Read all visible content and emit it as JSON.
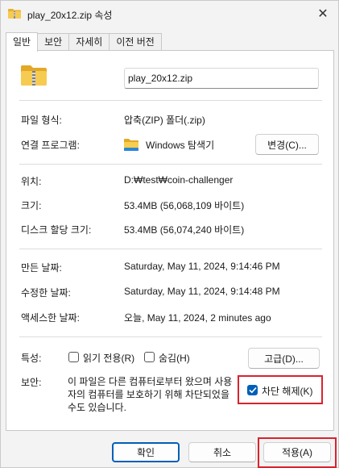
{
  "window": {
    "title": "play_20x12.zip 속성",
    "close_glyph": "✕"
  },
  "tabs": [
    {
      "label": "일반",
      "active": true
    },
    {
      "label": "보안",
      "active": false
    },
    {
      "label": "자세히",
      "active": false
    },
    {
      "label": "이전 버전",
      "active": false
    }
  ],
  "general": {
    "file_name": "play_20x12.zip",
    "file_type_label": "파일 형식:",
    "file_type_value": "압축(ZIP) 폴더(.zip)",
    "opens_with_label": "연결 프로그램:",
    "opens_with_value": "Windows 탐색기",
    "change_button": "변경(C)...",
    "location_label": "위치:",
    "location_value": "D:₩test₩coin-challenger",
    "size_label": "크기:",
    "size_value": "53.4MB (56,068,109 바이트)",
    "size_on_disk_label": "디스크 할당 크기:",
    "size_on_disk_value": "53.4MB (56,074,240 바이트)",
    "created_label": "만든 날짜:",
    "created_value": "Saturday, May 11, 2024, 9:14:46 PM",
    "modified_label": "수정한 날짜:",
    "modified_value": "Saturday, May 11, 2024, 9:14:48 PM",
    "accessed_label": "액세스한 날짜:",
    "accessed_value": "오늘, May 11, 2024, 2 minutes ago",
    "attributes_label": "특성:",
    "readonly_label": "읽기 전용(R)",
    "readonly_checked": false,
    "hidden_label": "숨김(H)",
    "hidden_checked": false,
    "advanced_button": "고급(D)...",
    "security_label": "보안:",
    "security_text": "이 파일은 다른 컴퓨터로부터 왔으며 사용자의 컴퓨터를 보호하기 위해 차단되었을 수도 있습니다.",
    "unblock_label": "차단 해제(K)",
    "unblock_checked": true
  },
  "footer": {
    "ok_button": "확인",
    "cancel_button": "취소",
    "apply_button": "적용(A)"
  },
  "icons": {
    "title": "zip-folder-icon",
    "file": "zip-folder-icon",
    "program": "file-explorer-icon",
    "check": "checkmark-icon"
  },
  "colors": {
    "accent": "#005fb8",
    "highlight": "#d9232e",
    "folder_yellow": "#f4c542"
  }
}
